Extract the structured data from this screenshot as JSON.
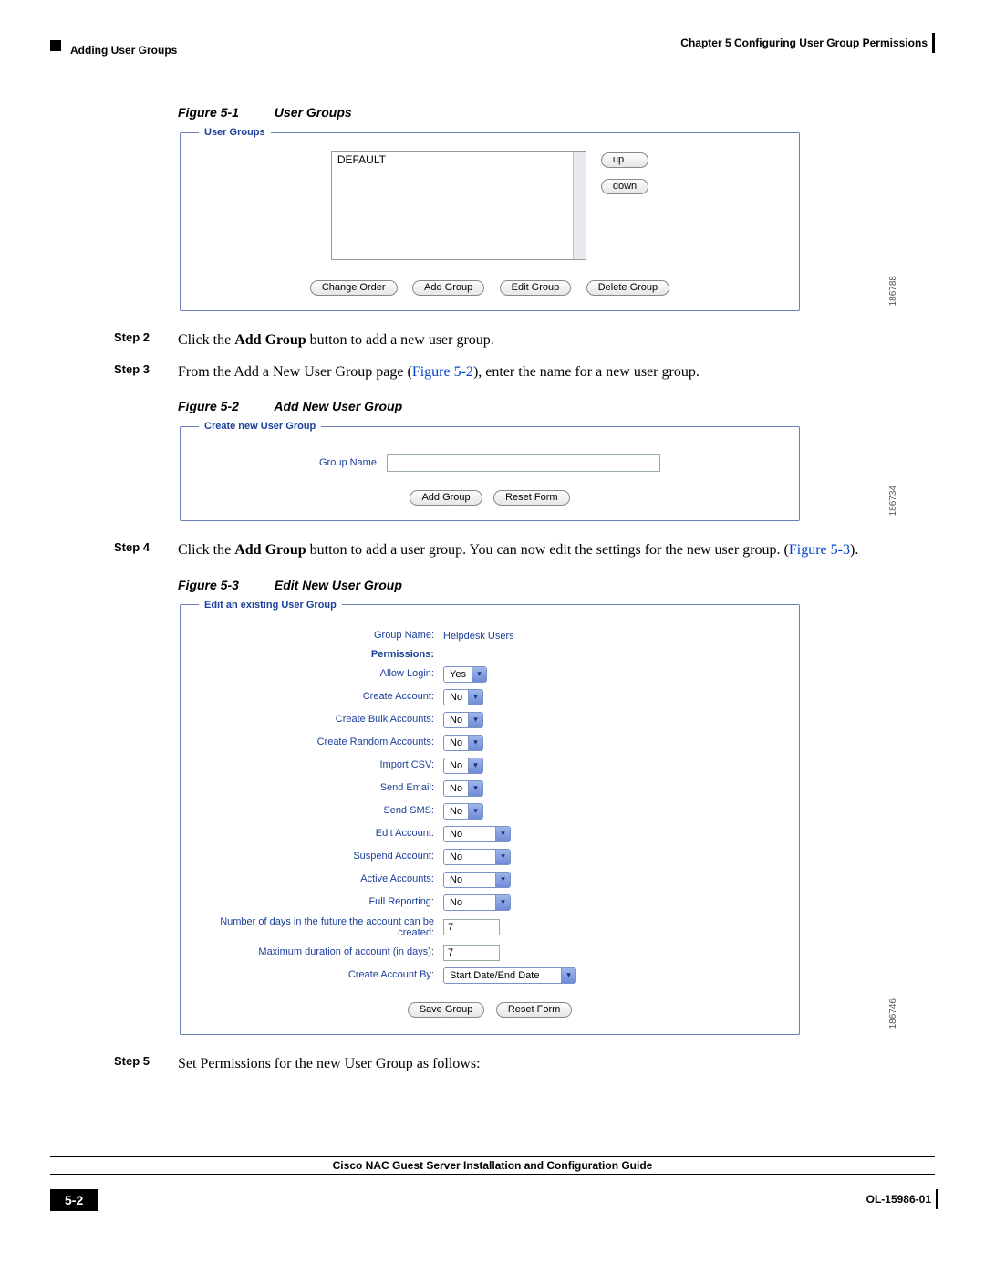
{
  "header": {
    "left": "Adding User Groups",
    "right": "Chapter 5    Configuring User Group Permissions"
  },
  "fig1": {
    "num": "Figure 5-1",
    "title": "User Groups",
    "legend": "User Groups",
    "item": "DEFAULT",
    "up": "up",
    "down": "down",
    "btn_change": "Change Order",
    "btn_add": "Add Group",
    "btn_edit": "Edit Group",
    "btn_del": "Delete Group",
    "sideid": "186788"
  },
  "step2": {
    "label": "Step 2",
    "pre": "Click the ",
    "bold": "Add Group",
    "post": " button to add a new user group."
  },
  "step3": {
    "label": "Step 3",
    "pre": "From the Add a New User Group page (",
    "link": "Figure 5-2",
    "post": "), enter the name for a new user group."
  },
  "fig2": {
    "num": "Figure 5-2",
    "title": "Add New User Group",
    "legend": "Create new User Group",
    "label": "Group Name:",
    "btn_add": "Add Group",
    "btn_reset": "Reset Form",
    "sideid": "186734"
  },
  "step4": {
    "label": "Step 4",
    "pre": "Click the ",
    "bold": "Add Group",
    "mid": " button to add a user group. You can now edit the settings for the new user group. (",
    "link": "Figure 5-3",
    "post": ")."
  },
  "fig3": {
    "num": "Figure 5-3",
    "title": "Edit New User Group",
    "legend": "Edit an existing User Group",
    "gn_label": "Group Name:",
    "gn_value": "Helpdesk Users",
    "perm_head": "Permissions:",
    "rows": {
      "allow_login": {
        "label": "Allow Login:",
        "value": "Yes"
      },
      "create_acct": {
        "label": "Create Account:",
        "value": "No"
      },
      "create_bulk": {
        "label": "Create Bulk Accounts:",
        "value": "No"
      },
      "create_rand": {
        "label": "Create Random Accounts:",
        "value": "No"
      },
      "import_csv": {
        "label": "Import CSV:",
        "value": "No"
      },
      "send_email": {
        "label": "Send Email:",
        "value": "No"
      },
      "send_sms": {
        "label": "Send SMS:",
        "value": "No"
      },
      "edit_acct": {
        "label": "Edit Account:",
        "value": "No"
      },
      "suspend_acct": {
        "label": "Suspend Account:",
        "value": "No"
      },
      "active_acct": {
        "label": "Active Accounts:",
        "value": "No"
      },
      "full_report": {
        "label": "Full Reporting:",
        "value": "No"
      },
      "days_future": {
        "label": "Number of days in the future the account can be created:",
        "value": "7"
      },
      "max_dur": {
        "label": "Maximum duration of account (in days):",
        "value": "7"
      },
      "create_by": {
        "label": "Create Account By:",
        "value": "Start Date/End Date"
      }
    },
    "btn_save": "Save Group",
    "btn_reset": "Reset Form",
    "sideid": "186746"
  },
  "step5": {
    "label": "Step 5",
    "text": "Set Permissions for the new User Group as follows:"
  },
  "footer": {
    "title": "Cisco NAC Guest Server Installation and Configuration Guide",
    "page": "5-2",
    "docid": "OL-15986-01"
  }
}
